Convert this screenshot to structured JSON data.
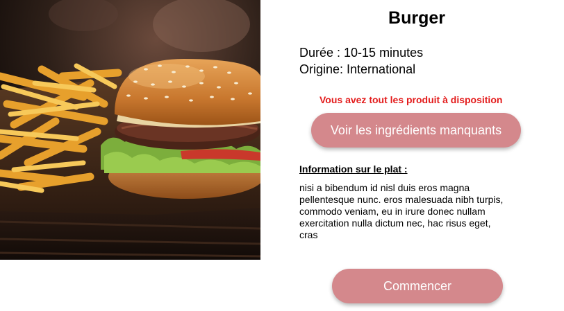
{
  "recipe": {
    "title": "Burger",
    "duration_label": "Durée : 10-15 minutes",
    "origin_label": "Origine: International",
    "availability_notice": "Vous avez tout les produit à disposition",
    "missing_ingredients_button": "Voir les ingrédients manquants",
    "info_heading": "Information sur le plat :",
    "info_text": "nisi a bibendum id nisl duis eros magna pellentesque nunc. eros malesuada nibh turpis, commodo veniam, eu in irure donec nullam exercitation nulla dictum nec, hac risus eget, cras",
    "start_button": "Commencer"
  },
  "colors": {
    "accent_button": "#d4888c",
    "notice_red": "#e31b1b"
  }
}
